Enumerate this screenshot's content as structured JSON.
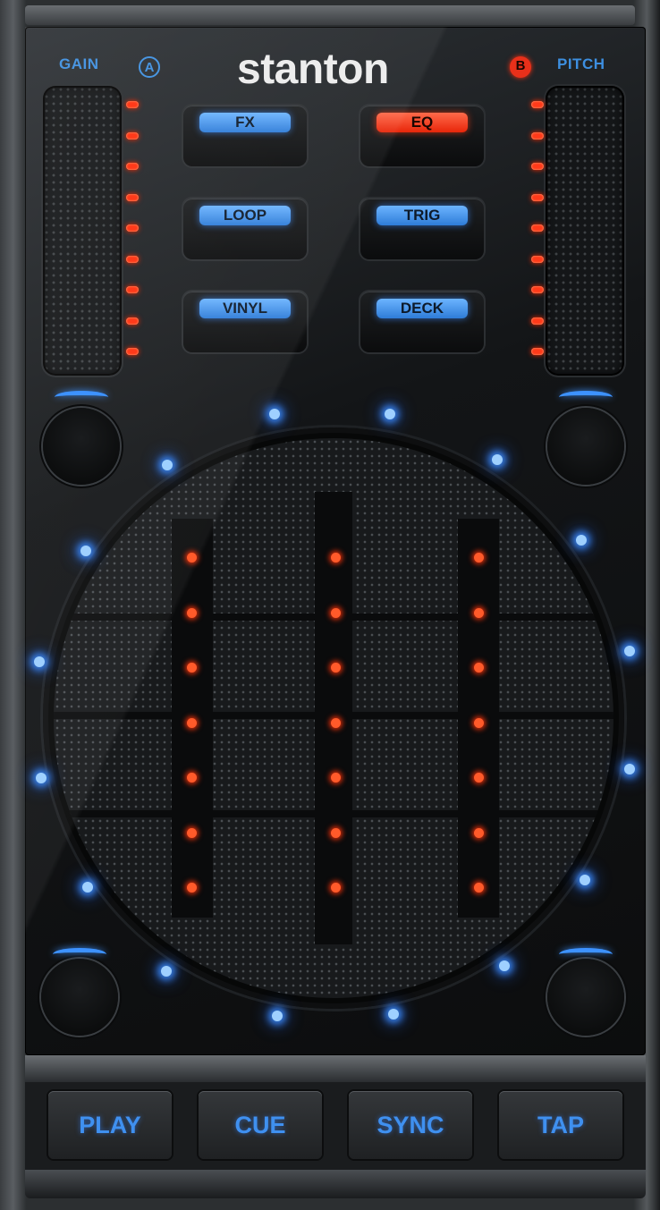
{
  "brand": {
    "logo_text": "stanton"
  },
  "labels": {
    "gain": "GAIN",
    "pitch": "PITCH",
    "deck_a": "A",
    "deck_b": "B"
  },
  "mode_buttons": {
    "left": [
      {
        "label": "FX",
        "light": "blue"
      },
      {
        "label": "LOOP",
        "light": "blue"
      },
      {
        "label": "VINYL",
        "light": "blue"
      }
    ],
    "right": [
      {
        "label": "EQ",
        "light": "red"
      },
      {
        "label": "TRIG",
        "light": "blue"
      },
      {
        "label": "DECK",
        "light": "blue"
      }
    ]
  },
  "transport_buttons": [
    "PLAY",
    "CUE",
    "SYNC",
    "TAP"
  ],
  "colors": {
    "accent_blue": "#3d8fe0",
    "accent_red": "#ff3a1a",
    "panel": "#0c0d0e"
  }
}
